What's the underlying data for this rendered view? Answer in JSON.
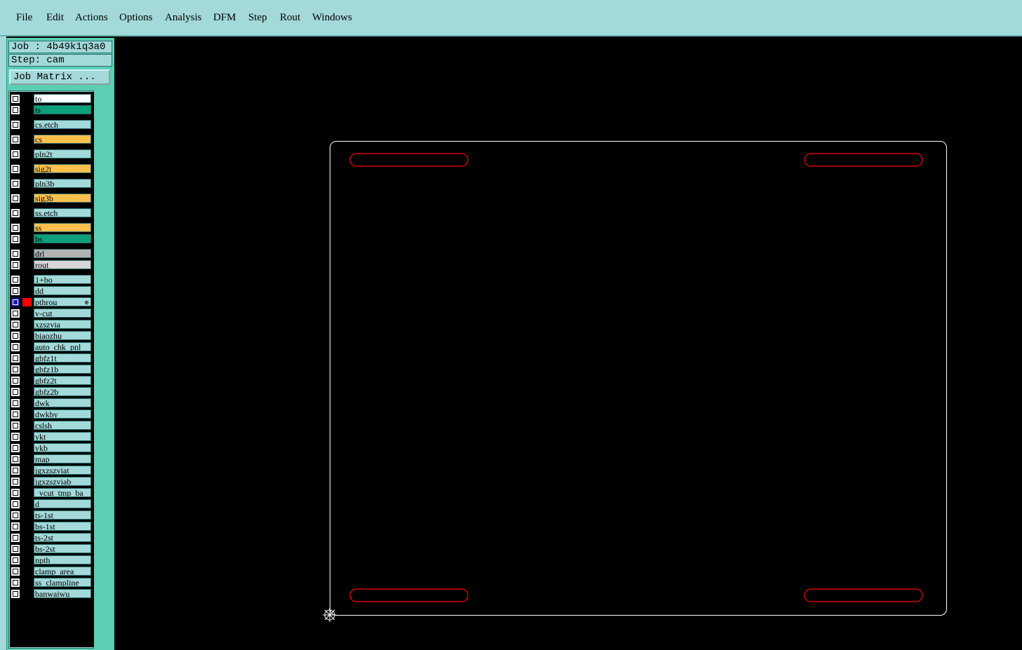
{
  "menu": {
    "items": [
      {
        "label": "File"
      },
      {
        "label": "Edit"
      },
      {
        "label": "Actions"
      },
      {
        "label": "Options"
      },
      {
        "label": "Analysis"
      },
      {
        "label": "DFM"
      },
      {
        "label": "Step"
      },
      {
        "label": "Rout"
      },
      {
        "label": "Windows"
      }
    ]
  },
  "panel": {
    "job": "Job : 4b49k1q3a0",
    "step": "Step: cam",
    "job_matrix_label": "Job Matrix ..."
  },
  "layers": [
    {
      "name": "to",
      "color": "#ffffff"
    },
    {
      "name": "ts",
      "color": "#0aa07a"
    },
    {
      "name": "cs.etch",
      "color": "#a3d9d9"
    },
    {
      "name": "cs",
      "color": "#ffc04d"
    },
    {
      "name": "pln2t",
      "color": "#a3d9d9"
    },
    {
      "name": "sig2t",
      "color": "#ffc04d"
    },
    {
      "name": "pln3b",
      "color": "#a3d9d9"
    },
    {
      "name": "sig3b",
      "color": "#ffc04d"
    },
    {
      "name": "ss.etch",
      "color": "#a3d9d9"
    },
    {
      "name": "ss",
      "color": "#ffc04d"
    },
    {
      "name": "bs",
      "color": "#0aa07a"
    },
    {
      "name": "drl",
      "color": "#b3b3b3"
    },
    {
      "name": "rout",
      "color": "#d6d6d6"
    },
    {
      "name": "1+bo",
      "color": "#a3d9d9"
    },
    {
      "name": "dd",
      "color": "#a3d9d9"
    },
    {
      "name": "pthrou",
      "color": "#a3d9d9",
      "active": true,
      "swatch": "#ff0000",
      "marker": "⊕"
    },
    {
      "name": "v-cut",
      "color": "#a3d9d9"
    },
    {
      "name": "xzszvia",
      "color": "#a3d9d9"
    },
    {
      "name": "biaozhu",
      "color": "#a3d9d9"
    },
    {
      "name": "auto_chk_pnl",
      "color": "#a3d9d9"
    },
    {
      "name": "gbfz1t",
      "color": "#a3d9d9"
    },
    {
      "name": "gbfz1b",
      "color": "#a3d9d9"
    },
    {
      "name": "gbfz2t",
      "color": "#a3d9d9"
    },
    {
      "name": "gbfz2b",
      "color": "#a3d9d9"
    },
    {
      "name": "dwk",
      "color": "#a3d9d9"
    },
    {
      "name": "dwkby",
      "color": "#a3d9d9"
    },
    {
      "name": "cslsh",
      "color": "#a3d9d9"
    },
    {
      "name": "ykt",
      "color": "#a3d9d9"
    },
    {
      "name": "ykb",
      "color": "#a3d9d9"
    },
    {
      "name": "map",
      "color": "#a3d9d9"
    },
    {
      "name": "jgxzszviat",
      "color": "#a3d9d9"
    },
    {
      "name": "jgxzszviab",
      "color": "#a3d9d9"
    },
    {
      "name": "_vcut_tmp_ba",
      "color": "#a3d9d9"
    },
    {
      "name": "d",
      "color": "#a3d9d9"
    },
    {
      "name": "ts-1st",
      "color": "#a3d9d9"
    },
    {
      "name": "bs-1st",
      "color": "#a3d9d9"
    },
    {
      "name": "ts-2st",
      "color": "#a3d9d9"
    },
    {
      "name": "bs-2st",
      "color": "#a3d9d9"
    },
    {
      "name": "npth",
      "color": "#a3d9d9"
    },
    {
      "name": "clamp_area",
      "color": "#a3d9d9"
    },
    {
      "name": "ss_clampline",
      "color": "#a3d9d9"
    },
    {
      "name": "banwaiwu",
      "color": "#a3d9d9"
    }
  ],
  "canvas": {
    "profile_color": "#ffffff",
    "slot_color": "#ff0000",
    "origin_icon": "crosshair-origin-icon"
  }
}
